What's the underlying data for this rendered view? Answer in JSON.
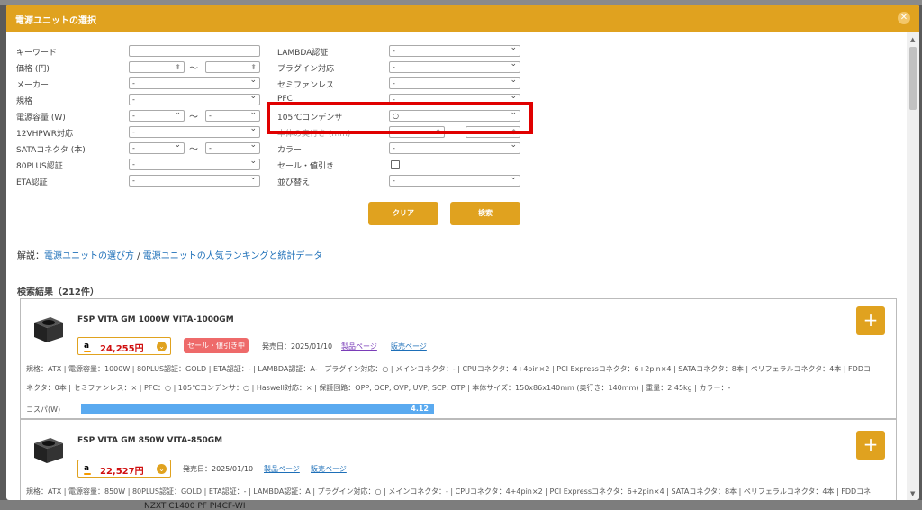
{
  "dialog": {
    "title": "電源ユニットの選択",
    "close_icon": "close-icon"
  },
  "filters_left": [
    {
      "label": "キーワード"
    },
    {
      "label": "価格 (円)"
    },
    {
      "label": "メーカー",
      "value": "-"
    },
    {
      "label": "規格",
      "value": "-"
    },
    {
      "label": "電源容量 (W)",
      "value_from": "-",
      "value_to": "-"
    },
    {
      "label": "12VHPWR対応",
      "value": "-"
    },
    {
      "label": "SATAコネクタ (本)",
      "value_from": "-",
      "value_to": "-"
    },
    {
      "label": "80PLUS認証",
      "value": "-"
    },
    {
      "label": "ETA認証",
      "value": "-"
    }
  ],
  "filters_right": [
    {
      "label": "LAMBDA認証",
      "value": "-"
    },
    {
      "label": "プラグイン対応",
      "value": "-"
    },
    {
      "label": "セミファンレス",
      "value": "-"
    },
    {
      "label": "PFC",
      "value": "-"
    },
    {
      "label": "105℃コンデンサ",
      "value": "○"
    },
    {
      "label": "本体の奥行き (mm)"
    },
    {
      "label": "カラー",
      "value": "-"
    },
    {
      "label": "セール・値引き"
    },
    {
      "label": "並び替え",
      "value": "-"
    }
  ],
  "tilde": "～",
  "buttons": {
    "clear": "クリア",
    "search": "検索"
  },
  "explain": {
    "prefix": "解説：",
    "link1": "電源ユニットの選び方",
    "sep": " / ",
    "link2": "電源ユニットの人気ランキングと統計データ"
  },
  "results_title": "検索結果（212件）",
  "products": [
    {
      "name": "FSP VITA GM 1000W VITA-1000GM",
      "store_letter": "a",
      "price": "24,255円",
      "sale_badge": "セール・値引き中",
      "release": "発売日：2025/01/10",
      "link_product": "製品ページ",
      "link_shop": "販売ページ",
      "plus": "+",
      "specs_line1": "規格：ATX | 電源容量：1000W | 80PLUS認証：GOLD | ETA認証：- | LAMBDA認証：A- | プラグイン対応：○ | メインコネクタ：- | CPUコネクタ：4+4pin×2 | PCI Expressコネクタ：6+2pin×4 | SATAコネクタ：8本 | ペリフェラルコネクタ：4本 | FDDコ",
      "specs_line2": "ネクタ：0本 | セミファンレス：× | PFC：○ | 105℃コンデンサ：○ | Haswell対応：× | 保護回路：OPP, OCP, OVP, UVP, SCP, OTP | 本体サイズ：150x86x140mm (奥行き：140mm) | 重量：2.45kg | カラー：-",
      "cospa_label": "コスパ(W)",
      "cospa_value": "4.12",
      "cospa_fill": 0.49
    },
    {
      "name": "FSP VITA GM 850W VITA-850GM",
      "store_letter": "a",
      "price": "22,527円",
      "release": "発売日：2025/01/10",
      "link_product": "製品ページ",
      "link_shop": "販売ページ",
      "plus": "+",
      "specs_line1": "規格：ATX | 電源容量：850W | 80PLUS認証：GOLD | ETA認証：- | LAMBDA認証：A | プラグイン対応：○ | メインコネクタ：- | CPUコネクタ：4+4pin×2 | PCI Expressコネクタ：6+2pin×4 | SATAコネクタ：8本 | ペリフェラルコネクタ：4本 | FDDコネ"
    }
  ],
  "background_text": "NZXT C1400 PF PI4CF-WI"
}
